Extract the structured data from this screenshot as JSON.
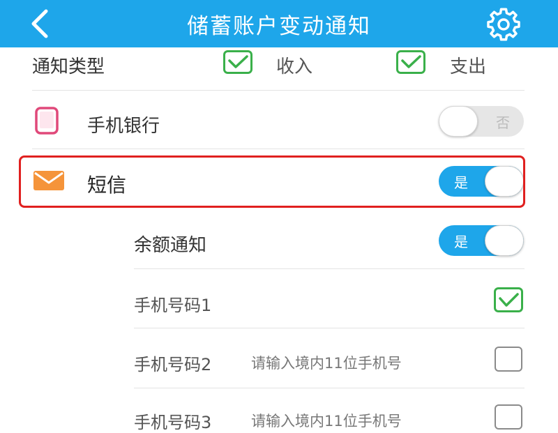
{
  "header": {
    "title": "储蓄账户变动通知",
    "bg_color": "#1ea6ea",
    "back_icon": "chevron-left-icon",
    "settings_icon": "gear-icon"
  },
  "notify_type": {
    "label": "通知类型",
    "options": [
      {
        "label": "收入",
        "checked": true
      },
      {
        "label": "支出",
        "checked": true
      }
    ]
  },
  "mobile_banking": {
    "label": "手机银行",
    "icon": "phone-icon",
    "toggle_text": "否",
    "enabled": false
  },
  "sms": {
    "label": "短信",
    "icon": "envelope-icon",
    "toggle_text": "是",
    "enabled": true,
    "highlight_color": "#e0201f"
  },
  "balance_notify": {
    "label": "余额通知",
    "toggle_text": "是",
    "enabled": true
  },
  "phones": [
    {
      "label": "手机号码1",
      "placeholder": "",
      "checked": true
    },
    {
      "label": "手机号码2",
      "placeholder": "请输入境内11位手机号",
      "checked": false
    },
    {
      "label": "手机号码3",
      "placeholder": "请输入境内11位手机号",
      "checked": false
    }
  ]
}
